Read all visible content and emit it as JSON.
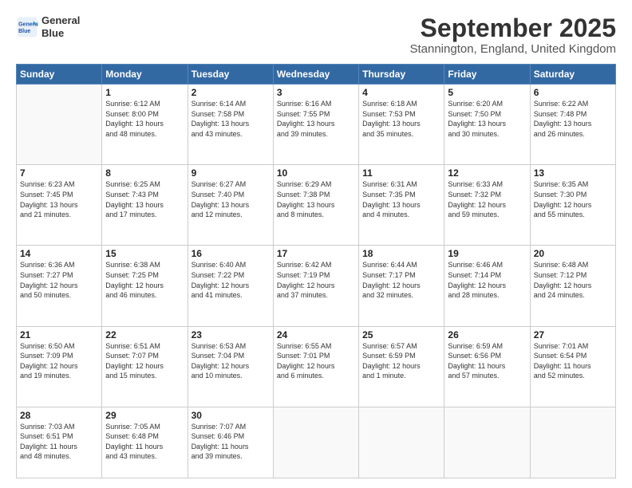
{
  "header": {
    "logo_line1": "General",
    "logo_line2": "Blue",
    "month": "September 2025",
    "location": "Stannington, England, United Kingdom"
  },
  "weekdays": [
    "Sunday",
    "Monday",
    "Tuesday",
    "Wednesday",
    "Thursday",
    "Friday",
    "Saturday"
  ],
  "weeks": [
    [
      {
        "day": "",
        "info": ""
      },
      {
        "day": "1",
        "info": "Sunrise: 6:12 AM\nSunset: 8:00 PM\nDaylight: 13 hours\nand 48 minutes."
      },
      {
        "day": "2",
        "info": "Sunrise: 6:14 AM\nSunset: 7:58 PM\nDaylight: 13 hours\nand 43 minutes."
      },
      {
        "day": "3",
        "info": "Sunrise: 6:16 AM\nSunset: 7:55 PM\nDaylight: 13 hours\nand 39 minutes."
      },
      {
        "day": "4",
        "info": "Sunrise: 6:18 AM\nSunset: 7:53 PM\nDaylight: 13 hours\nand 35 minutes."
      },
      {
        "day": "5",
        "info": "Sunrise: 6:20 AM\nSunset: 7:50 PM\nDaylight: 13 hours\nand 30 minutes."
      },
      {
        "day": "6",
        "info": "Sunrise: 6:22 AM\nSunset: 7:48 PM\nDaylight: 13 hours\nand 26 minutes."
      }
    ],
    [
      {
        "day": "7",
        "info": "Sunrise: 6:23 AM\nSunset: 7:45 PM\nDaylight: 13 hours\nand 21 minutes."
      },
      {
        "day": "8",
        "info": "Sunrise: 6:25 AM\nSunset: 7:43 PM\nDaylight: 13 hours\nand 17 minutes."
      },
      {
        "day": "9",
        "info": "Sunrise: 6:27 AM\nSunset: 7:40 PM\nDaylight: 13 hours\nand 12 minutes."
      },
      {
        "day": "10",
        "info": "Sunrise: 6:29 AM\nSunset: 7:38 PM\nDaylight: 13 hours\nand 8 minutes."
      },
      {
        "day": "11",
        "info": "Sunrise: 6:31 AM\nSunset: 7:35 PM\nDaylight: 13 hours\nand 4 minutes."
      },
      {
        "day": "12",
        "info": "Sunrise: 6:33 AM\nSunset: 7:32 PM\nDaylight: 12 hours\nand 59 minutes."
      },
      {
        "day": "13",
        "info": "Sunrise: 6:35 AM\nSunset: 7:30 PM\nDaylight: 12 hours\nand 55 minutes."
      }
    ],
    [
      {
        "day": "14",
        "info": "Sunrise: 6:36 AM\nSunset: 7:27 PM\nDaylight: 12 hours\nand 50 minutes."
      },
      {
        "day": "15",
        "info": "Sunrise: 6:38 AM\nSunset: 7:25 PM\nDaylight: 12 hours\nand 46 minutes."
      },
      {
        "day": "16",
        "info": "Sunrise: 6:40 AM\nSunset: 7:22 PM\nDaylight: 12 hours\nand 41 minutes."
      },
      {
        "day": "17",
        "info": "Sunrise: 6:42 AM\nSunset: 7:19 PM\nDaylight: 12 hours\nand 37 minutes."
      },
      {
        "day": "18",
        "info": "Sunrise: 6:44 AM\nSunset: 7:17 PM\nDaylight: 12 hours\nand 32 minutes."
      },
      {
        "day": "19",
        "info": "Sunrise: 6:46 AM\nSunset: 7:14 PM\nDaylight: 12 hours\nand 28 minutes."
      },
      {
        "day": "20",
        "info": "Sunrise: 6:48 AM\nSunset: 7:12 PM\nDaylight: 12 hours\nand 24 minutes."
      }
    ],
    [
      {
        "day": "21",
        "info": "Sunrise: 6:50 AM\nSunset: 7:09 PM\nDaylight: 12 hours\nand 19 minutes."
      },
      {
        "day": "22",
        "info": "Sunrise: 6:51 AM\nSunset: 7:07 PM\nDaylight: 12 hours\nand 15 minutes."
      },
      {
        "day": "23",
        "info": "Sunrise: 6:53 AM\nSunset: 7:04 PM\nDaylight: 12 hours\nand 10 minutes."
      },
      {
        "day": "24",
        "info": "Sunrise: 6:55 AM\nSunset: 7:01 PM\nDaylight: 12 hours\nand 6 minutes."
      },
      {
        "day": "25",
        "info": "Sunrise: 6:57 AM\nSunset: 6:59 PM\nDaylight: 12 hours\nand 1 minute."
      },
      {
        "day": "26",
        "info": "Sunrise: 6:59 AM\nSunset: 6:56 PM\nDaylight: 11 hours\nand 57 minutes."
      },
      {
        "day": "27",
        "info": "Sunrise: 7:01 AM\nSunset: 6:54 PM\nDaylight: 11 hours\nand 52 minutes."
      }
    ],
    [
      {
        "day": "28",
        "info": "Sunrise: 7:03 AM\nSunset: 6:51 PM\nDaylight: 11 hours\nand 48 minutes."
      },
      {
        "day": "29",
        "info": "Sunrise: 7:05 AM\nSunset: 6:48 PM\nDaylight: 11 hours\nand 43 minutes."
      },
      {
        "day": "30",
        "info": "Sunrise: 7:07 AM\nSunset: 6:46 PM\nDaylight: 11 hours\nand 39 minutes."
      },
      {
        "day": "",
        "info": ""
      },
      {
        "day": "",
        "info": ""
      },
      {
        "day": "",
        "info": ""
      },
      {
        "day": "",
        "info": ""
      }
    ]
  ]
}
